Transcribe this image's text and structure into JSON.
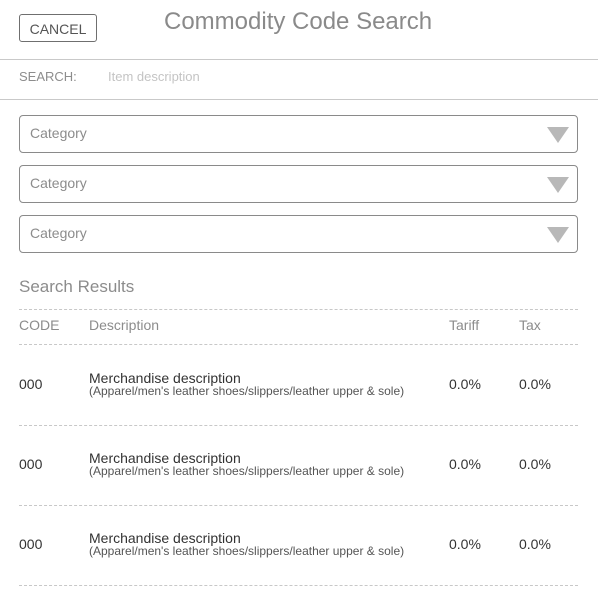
{
  "header": {
    "cancel_label": "CANCEL",
    "title": "Commodity Code Search"
  },
  "search": {
    "label": "SEARCH:",
    "placeholder": "Item description",
    "value": ""
  },
  "categories": [
    {
      "label": "Category"
    },
    {
      "label": "Category"
    },
    {
      "label": "Category"
    }
  ],
  "results": {
    "heading": "Search Results",
    "columns": {
      "code": "CODE",
      "description": "Description",
      "tariff": "Tariff",
      "tax": "Tax"
    },
    "rows": [
      {
        "code": "000",
        "description": "Merchandise description",
        "detail": "(Apparel/men's leather shoes/slippers/leather upper & sole)",
        "tariff": "0.0%",
        "tax": "0.0%"
      },
      {
        "code": "000",
        "description": "Merchandise description",
        "detail": "(Apparel/men's leather shoes/slippers/leather upper & sole)",
        "tariff": "0.0%",
        "tax": "0.0%"
      },
      {
        "code": "000",
        "description": "Merchandise description",
        "detail": "(Apparel/men's leather shoes/slippers/leather upper & sole)",
        "tariff": "0.0%",
        "tax": "0.0%"
      }
    ]
  },
  "colors": {
    "border": "#8a8a8a",
    "muted_text": "#8c8c8c",
    "body_text": "#333333"
  }
}
